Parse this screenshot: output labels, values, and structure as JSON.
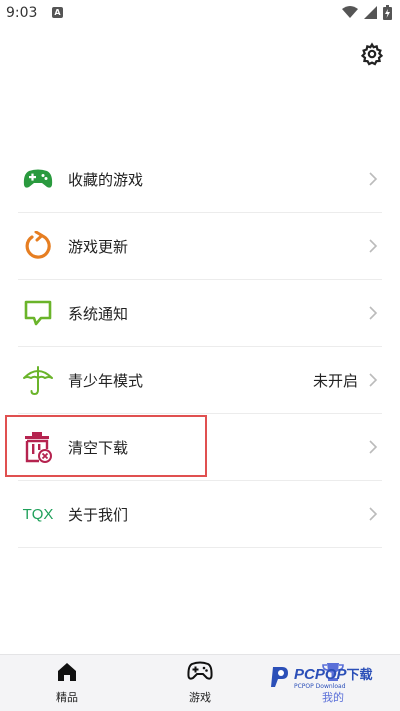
{
  "status_bar": {
    "time": "9:03",
    "notification_badge": "A"
  },
  "menu": [
    {
      "id": "favorites",
      "label": "收藏的游戏",
      "value": "",
      "icon": "gamepad-icon",
      "color": "#2a9a3e"
    },
    {
      "id": "updates",
      "label": "游戏更新",
      "value": "",
      "icon": "refresh-icon",
      "color": "#e67e22"
    },
    {
      "id": "notifications",
      "label": "系统通知",
      "value": "",
      "icon": "message-icon",
      "color": "#6ab42a"
    },
    {
      "id": "teen_mode",
      "label": "青少年模式",
      "value": "未开启",
      "icon": "umbrella-icon",
      "color": "#6ab42a"
    },
    {
      "id": "clear_downloads",
      "label": "清空下载",
      "value": "",
      "icon": "trash-icon",
      "color": "#b5234f"
    },
    {
      "id": "about",
      "label": "关于我们",
      "value": "",
      "icon_text": "TQX",
      "icon": "tqx-logo-icon",
      "color": "#1fa05a"
    }
  ],
  "tabs": [
    {
      "id": "featured",
      "label": "精品",
      "icon": "home-icon",
      "active": false
    },
    {
      "id": "games",
      "label": "游戏",
      "icon": "gamepad-icon",
      "active": false
    },
    {
      "id": "mine",
      "label": "我的",
      "icon": "trophy-icon",
      "active": true
    }
  ],
  "watermark": {
    "brand": "PCPOP",
    "suffix": "下载",
    "small": "PCPOP Download"
  },
  "colors": {
    "highlight": "#e05050",
    "active_tab": "#5a6fd8"
  }
}
